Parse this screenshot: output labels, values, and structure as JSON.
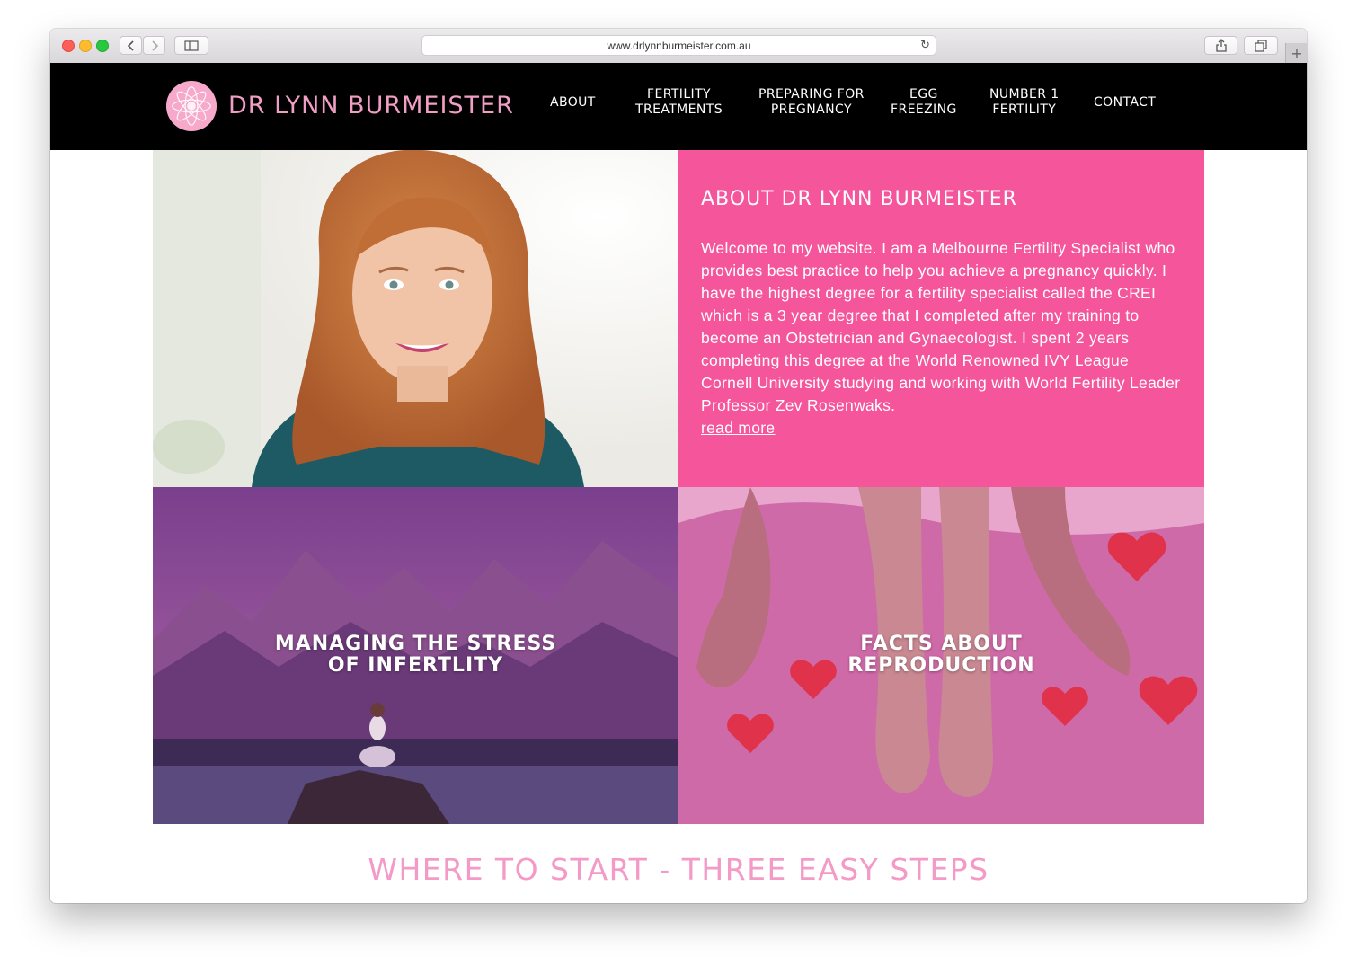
{
  "browser": {
    "url": "www.drlynnburmeister.com.au",
    "back_icon": "chevron-left-icon",
    "forward_icon": "chevron-right-icon",
    "sidebar_icon": "sidebar-icon",
    "reload_icon": "reload-icon",
    "share_icon": "share-icon",
    "tabs_icon": "tabs-icon",
    "new_tab_icon": "plus-icon"
  },
  "site": {
    "logo_text": "DR LYNN BURMEISTER",
    "logo_icon": "lotus-icon",
    "brand_pink": "#f4559b",
    "nav": [
      {
        "label": "ABOUT"
      },
      {
        "label": "FERTILITY\nTREATMENTS"
      },
      {
        "label": "PREPARING FOR\nPREGNANCY"
      },
      {
        "label": "EGG\nFREEZING"
      },
      {
        "label": "NUMBER 1\nFERTILITY"
      },
      {
        "label": "CONTACT"
      }
    ]
  },
  "about": {
    "title": "ABOUT DR LYNN BURMEISTER",
    "body": "Welcome to my website. I am a Melbourne Fertility Specialist who provides best practice to help you achieve a pregnancy quickly. I have the highest degree for a fertility specialist called the CREI which is a 3 year degree that I completed after my training to become an Obstetrician and Gynaecologist. I spent 2 years completing this degree at the World Renowned IVY League Cornell University studying and working with World Fertility Leader Professor Zev Rosenwaks.",
    "read_more": "read more"
  },
  "tiles": [
    {
      "label": "MANAGING THE STRESS\nOF INFERTLITY"
    },
    {
      "label": "FACTS ABOUT\nREPRODUCTION"
    }
  ],
  "steps_heading": "WHERE TO START - THREE EASY STEPS"
}
